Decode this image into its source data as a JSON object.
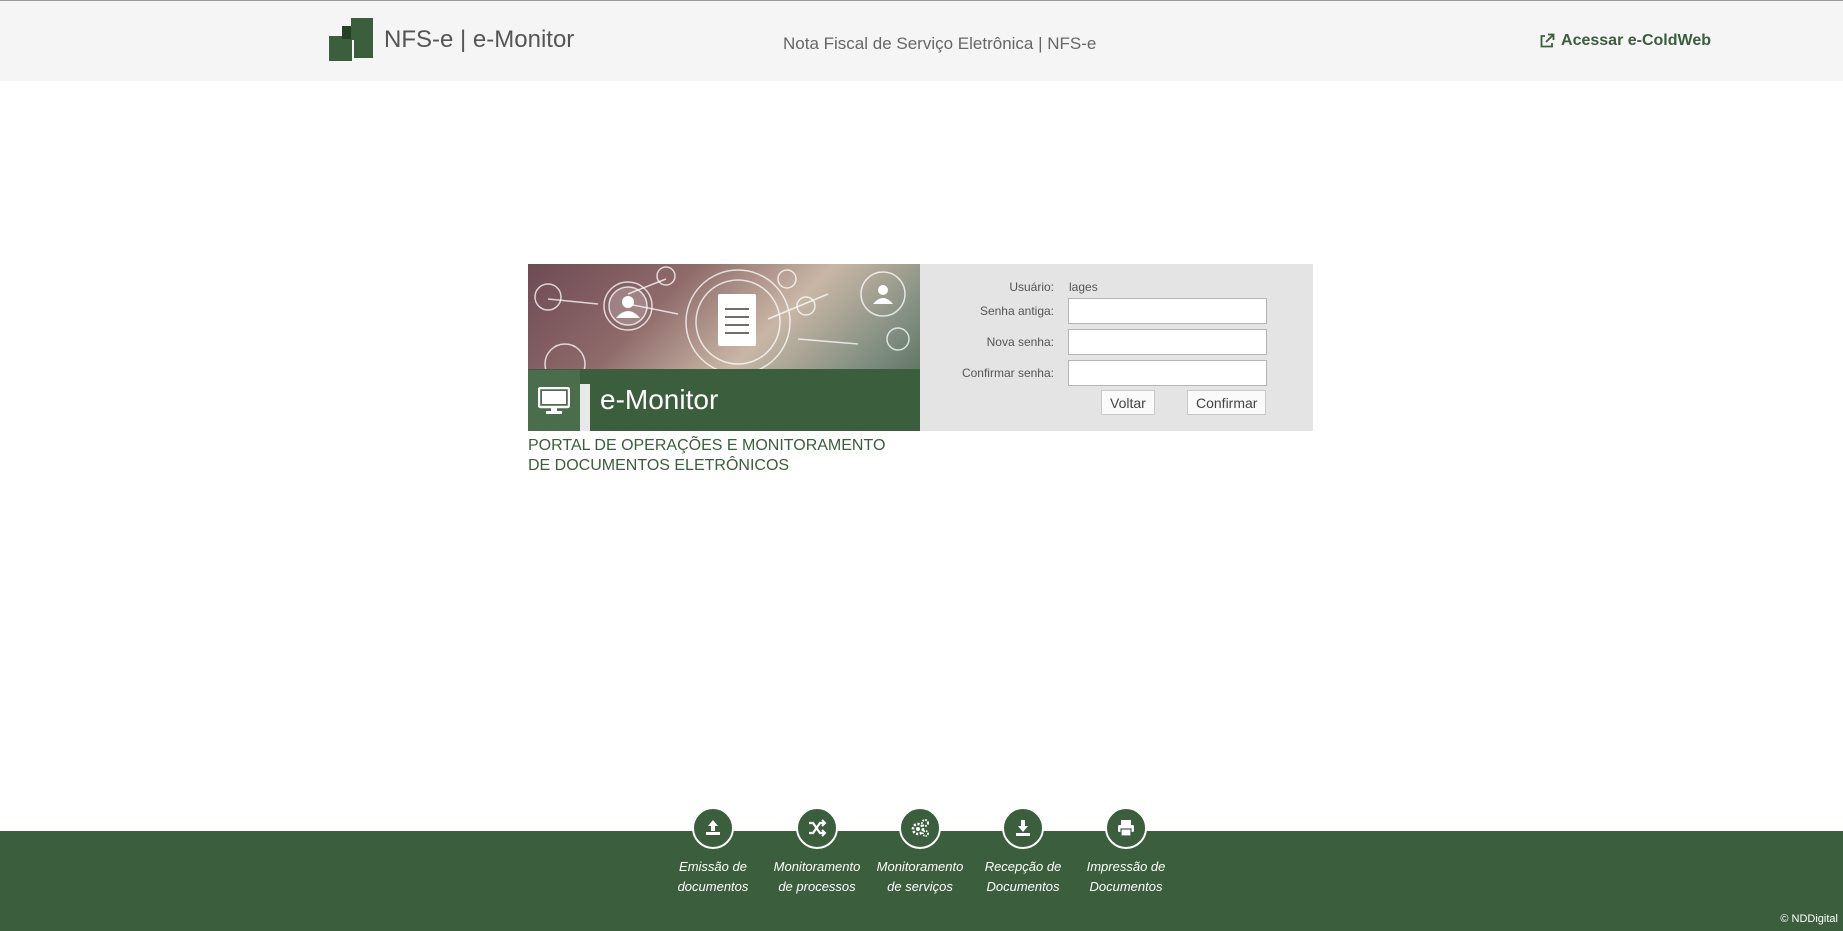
{
  "header": {
    "brand": "NFS-e | e-Monitor",
    "subtitle": "Nota Fiscal de Serviço Eletrônica | NFS-e",
    "coldweb_link": "Acessar e-ColdWeb"
  },
  "banner": {
    "title": "e-Monitor",
    "tagline_line1": "PORTAL DE OPERAÇÕES E MONITORAMENTO",
    "tagline_line2": "DE DOCUMENTOS ELETRÔNICOS"
  },
  "form": {
    "user_label": "Usuário:",
    "user_value": "lages",
    "old_password_label": "Senha antiga:",
    "new_password_label": "Nova senha:",
    "confirm_password_label": "Confirmar senha:",
    "old_password_value": "",
    "new_password_value": "",
    "confirm_password_value": "",
    "back_button": "Voltar",
    "confirm_button": "Confirmar"
  },
  "footer": {
    "items": [
      {
        "line1": "Emissão de",
        "line2": "documentos",
        "icon": "upload-icon"
      },
      {
        "line1": "Monitoramento",
        "line2": "de processos",
        "icon": "shuffle-icon"
      },
      {
        "line1": "Monitoramento",
        "line2": "de serviços",
        "icon": "gears-icon"
      },
      {
        "line1": "Recepção de",
        "line2": "Documentos",
        "icon": "download-icon"
      },
      {
        "line1": "Impressão de",
        "line2": "Documentos",
        "icon": "print-icon"
      }
    ],
    "copyright": "© NDDigital"
  },
  "colors": {
    "brand_green": "#3b5e3c",
    "header_bg": "#f5f5f5",
    "form_bg": "#e4e4e4"
  }
}
